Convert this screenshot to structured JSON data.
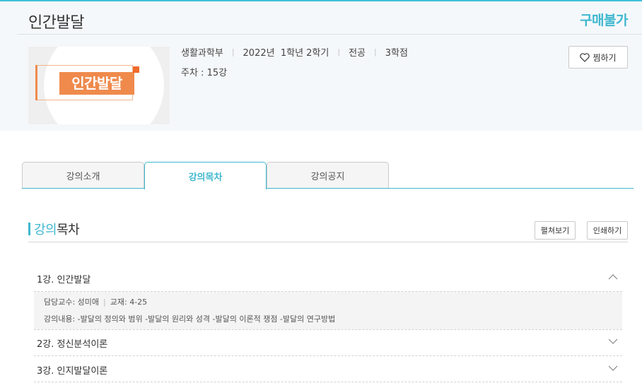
{
  "header": {
    "course_title": "인간발달",
    "buy_status": "구매불가",
    "thumbnail_text": "인간발달",
    "meta": {
      "department": "생활과학부",
      "term": "2022년  1학년 2학기",
      "category": "전공",
      "credits": "3학점",
      "weeks": "주차 : 15강"
    },
    "wish_label": "찜하기",
    "wish_icon": "heart-icon"
  },
  "tabs": [
    {
      "label": "강의소개",
      "active": false
    },
    {
      "label": "강의목차",
      "active": true
    },
    {
      "label": "강의공지",
      "active": false
    }
  ],
  "section": {
    "title_highlight": "강의",
    "title_rest": "목차",
    "expand_label": "펼쳐보기",
    "print_label": "인쇄하기"
  },
  "lessons": [
    {
      "title": "1강. 인간발달",
      "expanded": true,
      "professor": "담당교수: 성미애",
      "textbook": "교재: 4-25",
      "content": "강의내용: -발달의 정의와 범위 -발달의 원리와 성격 -발달의 이론적 쟁점 -발달의 연구방법"
    },
    {
      "title": "2강. 정신분석이론",
      "expanded": false
    },
    {
      "title": "3강. 인지발달이론",
      "expanded": false
    }
  ],
  "colors": {
    "accent": "#3fb7cf",
    "thumbnail_orange": "#ef8a4c"
  }
}
